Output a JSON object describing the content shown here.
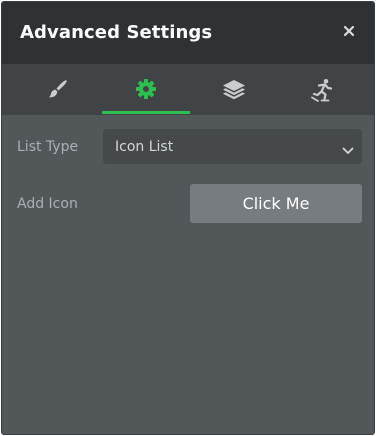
{
  "header": {
    "title": "Advanced Settings",
    "close_icon": "close-icon"
  },
  "tabs": [
    {
      "icon": "paintbrush-icon",
      "active": false
    },
    {
      "icon": "gear-icon",
      "active": true
    },
    {
      "icon": "layers-icon",
      "active": false
    },
    {
      "icon": "skating-figure-icon",
      "active": false
    }
  ],
  "fields": {
    "list_type": {
      "label": "List Type",
      "value": "Icon List"
    },
    "add_icon": {
      "label": "Add Icon",
      "button_label": "Click Me"
    }
  },
  "colors": {
    "accent": "#2ec04f",
    "header_bg": "#2f3234",
    "panel_bg": "#52575a"
  }
}
